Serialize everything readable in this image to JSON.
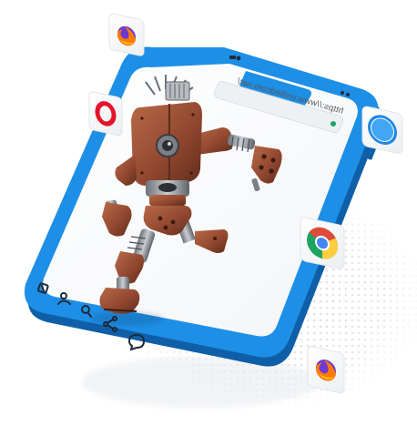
{
  "browser": {
    "url": "https://www.unifiedcom.net/"
  },
  "browser_icons": [
    {
      "name": "firefox",
      "icon": "firefox-icon"
    },
    {
      "name": "opera",
      "icon": "opera-icon"
    },
    {
      "name": "safari",
      "icon": "safari-icon"
    },
    {
      "name": "chrome",
      "icon": "chrome-icon"
    },
    {
      "name": "firefox",
      "icon": "firefox-icon"
    }
  ],
  "colors": {
    "phone_frame": "#1e8fe6",
    "phone_frame_shadow": "#0f5fa8",
    "robot_body": "#9a4e32",
    "robot_dark": "#5a2d1c",
    "opera_red": "#e3152b",
    "chrome_green": "#1da462",
    "chrome_yellow": "#ffcd40",
    "chrome_red": "#dd4b39",
    "chrome_blue": "#4285f4",
    "firefox_orange": "#ff7a00",
    "firefox_purple": "#6d38d6",
    "safari_blue": "#1e88e5"
  }
}
